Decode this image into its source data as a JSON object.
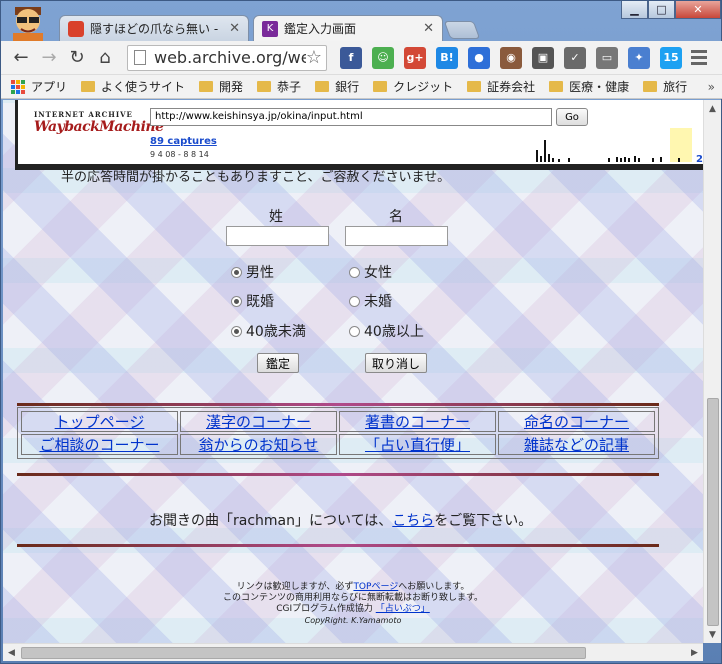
{
  "browser": {
    "tabs": [
      {
        "title": "隠すほどの爪なら無い - I",
        "icon_color": "#d9412b"
      },
      {
        "title": "鑑定入力画面",
        "icon_color": "#7a2a9a"
      }
    ],
    "url": "web.archive.org/we",
    "extensions": [
      {
        "name": "facebook-icon",
        "label": "f",
        "color": "#3b5998"
      },
      {
        "name": "robot-icon",
        "label": "☺",
        "color": "#4caf50"
      },
      {
        "name": "google-plus-icon",
        "label": "g+",
        "color": "#d34836"
      },
      {
        "name": "hatena-bookmark-icon",
        "label": "B!",
        "color": "#1e88e5"
      },
      {
        "name": "chat-icon",
        "label": "●",
        "color": "#2e6fd8"
      },
      {
        "name": "instagram-icon",
        "label": "◉",
        "color": "#8a5a3c"
      },
      {
        "name": "frame-icon",
        "label": "▣",
        "color": "#555555"
      },
      {
        "name": "check-icon",
        "label": "✓",
        "color": "#6a6a6a"
      },
      {
        "name": "cast-icon",
        "label": "▭",
        "color": "#777777"
      },
      {
        "name": "puzzle-icon",
        "label": "✦",
        "color": "#4a7fd0"
      },
      {
        "name": "twitter-icon",
        "label": "15",
        "color": "#1da1f2"
      }
    ],
    "bookmarks": [
      {
        "label": "アプリ",
        "type": "apps"
      },
      {
        "label": "よく使うサイト",
        "type": "folder"
      },
      {
        "label": "開発",
        "type": "folder"
      },
      {
        "label": "恭子",
        "type": "folder"
      },
      {
        "label": "銀行",
        "type": "folder"
      },
      {
        "label": "クレジット",
        "type": "folder"
      },
      {
        "label": "証券会社",
        "type": "folder"
      },
      {
        "label": "医療・健康",
        "type": "folder"
      },
      {
        "label": "旅行",
        "type": "folder"
      }
    ],
    "bookmarks_more": "»",
    "window_controls": {
      "minimize": "▁",
      "maximize": "□",
      "close": "✕"
    }
  },
  "wayback": {
    "logo_small": "INTERNET ARCHIVE",
    "logo_big": "WaybackMachine",
    "url": "http://www.keishinsya.jp/okina/input.html",
    "go_label": "Go",
    "captures": "89 captures",
    "dates": "9 4 08 - 8 8 14",
    "year_partial": "2"
  },
  "page": {
    "intro": "半の応答時間が掛かることもありますこと、ご容赦くださいませ。",
    "surname_label": "姓",
    "given_label": "名",
    "radios": [
      {
        "left": "男性",
        "right": "女性",
        "left_checked": true,
        "right_checked": false
      },
      {
        "left": "既婚",
        "right": "未婚",
        "left_checked": true,
        "right_checked": false
      },
      {
        "left": "40歳未満",
        "right": "40歳以上",
        "left_checked": true,
        "right_checked": false
      }
    ],
    "submit_label": "鑑定",
    "reset_label": "取り消し",
    "nav": [
      [
        "トップページ",
        "漢字のコーナー",
        "著書のコーナー",
        "命名のコーナー"
      ],
      [
        "ご相談のコーナー",
        "翁からのお知らせ",
        "「占い直行便」",
        "雑誌などの記事"
      ]
    ],
    "music_prefix": "お聞きの曲「rachman」については、",
    "music_link": "こちら",
    "music_suffix": "をご覧下さい。",
    "footer_line1_prefix": "リンクは歓迎しますが、必ず",
    "footer_line1_link": "TOPページ",
    "footer_line1_suffix": "へお願いします。",
    "footer_line2": "このコンテンツの商用利用ならびに無断転載はお断り致します。",
    "footer_line3_prefix": "CGIプログラム作成協力 ",
    "footer_line3_link": "「占いぷつ」",
    "footer_line4": "CopyRight. K.Yamamoto"
  }
}
